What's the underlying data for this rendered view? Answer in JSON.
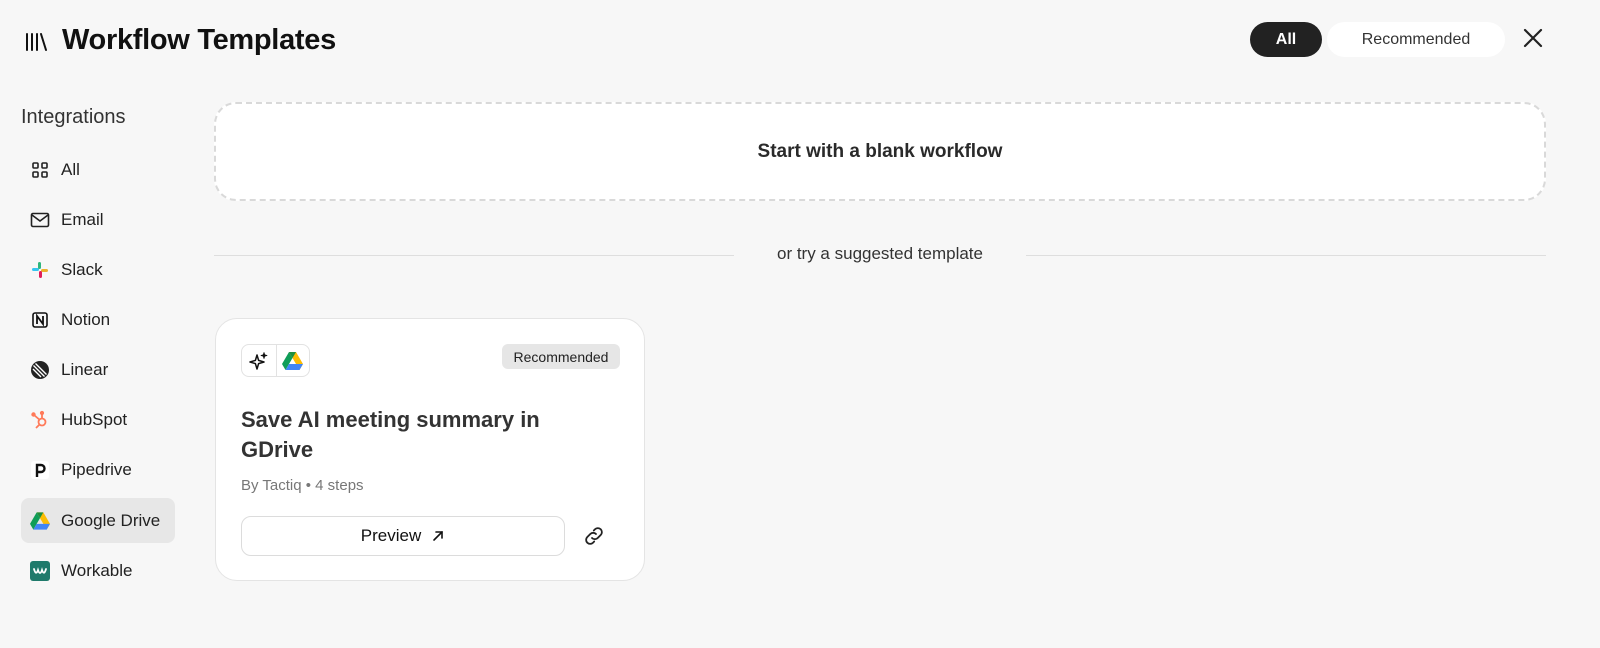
{
  "header": {
    "title": "Workflow Templates",
    "filters": [
      {
        "label": "All",
        "active": true
      },
      {
        "label": "Recommended",
        "active": false
      }
    ],
    "icon": "library-icon",
    "close_icon": "close-icon"
  },
  "sidebar": {
    "heading": "Integrations",
    "items": [
      {
        "label": "All",
        "icon": "grid-icon",
        "active": false
      },
      {
        "label": "Email",
        "icon": "mail-icon",
        "active": false
      },
      {
        "label": "Slack",
        "icon": "slack-icon",
        "active": false
      },
      {
        "label": "Notion",
        "icon": "notion-icon",
        "active": false
      },
      {
        "label": "Linear",
        "icon": "linear-icon",
        "active": false
      },
      {
        "label": "HubSpot",
        "icon": "hubspot-icon",
        "active": false
      },
      {
        "label": "Pipedrive",
        "icon": "pipedrive-icon",
        "active": false
      },
      {
        "label": "Google Drive",
        "icon": "google-drive-icon",
        "active": true
      },
      {
        "label": "Workable",
        "icon": "workable-icon",
        "active": false
      }
    ]
  },
  "main": {
    "blank_label": "Start with a blank workflow",
    "divider_label": "or try a suggested template",
    "templates": [
      {
        "title": "Save AI meeting summary in GDrive",
        "badge": "Recommended",
        "author": "By Tactiq",
        "steps": "4 steps",
        "meta": "By Tactiq • 4 steps",
        "icons": [
          "sparkles-icon",
          "google-drive-icon"
        ],
        "preview_label": "Preview"
      }
    ]
  },
  "colors": {
    "background": "#f7f7f7",
    "active_filter": "#222222",
    "card": "#ffffff",
    "active_sidebar": "#e7e7e7",
    "hubspot": "#ff7a59",
    "workable": "#1f7a6b"
  }
}
